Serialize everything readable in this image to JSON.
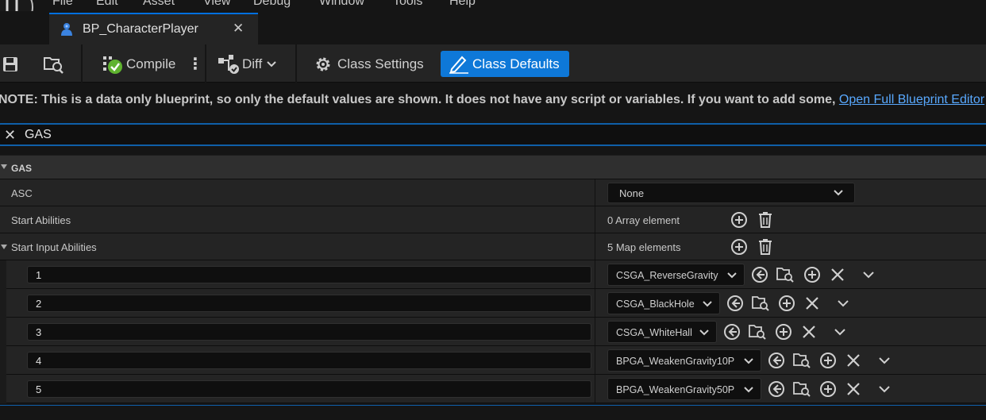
{
  "menu": {
    "items": [
      "File",
      "Edit",
      "Asset",
      "View",
      "Debug",
      "Window",
      "Tools",
      "Help"
    ]
  },
  "tab": {
    "title": "BP_CharacterPlayer",
    "close": "✕"
  },
  "toolbar": {
    "compile_label": "Compile",
    "more_label": "⋮",
    "diff_label": "Diff",
    "class_settings_label": "Class Settings",
    "class_defaults_label": "Class Defaults",
    "accent": "#0e78d8"
  },
  "note": {
    "text": "NOTE: This is a data only blueprint, so only the default values are shown.  It does not have any script or variables.  If you want to add some, ",
    "link": "Open Full Blueprint Editor"
  },
  "search": {
    "clear": "✕",
    "value": "GAS"
  },
  "details": {
    "category": "GAS",
    "asc": {
      "label": "ASC",
      "value": "None"
    },
    "start_abilities": {
      "label": "Start Abilities",
      "value": "0 Array element"
    },
    "start_input_abilities": {
      "label": "Start Input Abilities",
      "value": "5 Map elements",
      "entries": [
        {
          "key": "1",
          "value": "CSGA_ReverseGravity"
        },
        {
          "key": "2",
          "value": "CSGA_BlackHole"
        },
        {
          "key": "3",
          "value": "CSGA_WhiteHall"
        },
        {
          "key": "4",
          "value": "BPGA_WeakenGravity10P"
        },
        {
          "key": "5",
          "value": "BPGA_WeakenGravity50P"
        }
      ]
    }
  }
}
